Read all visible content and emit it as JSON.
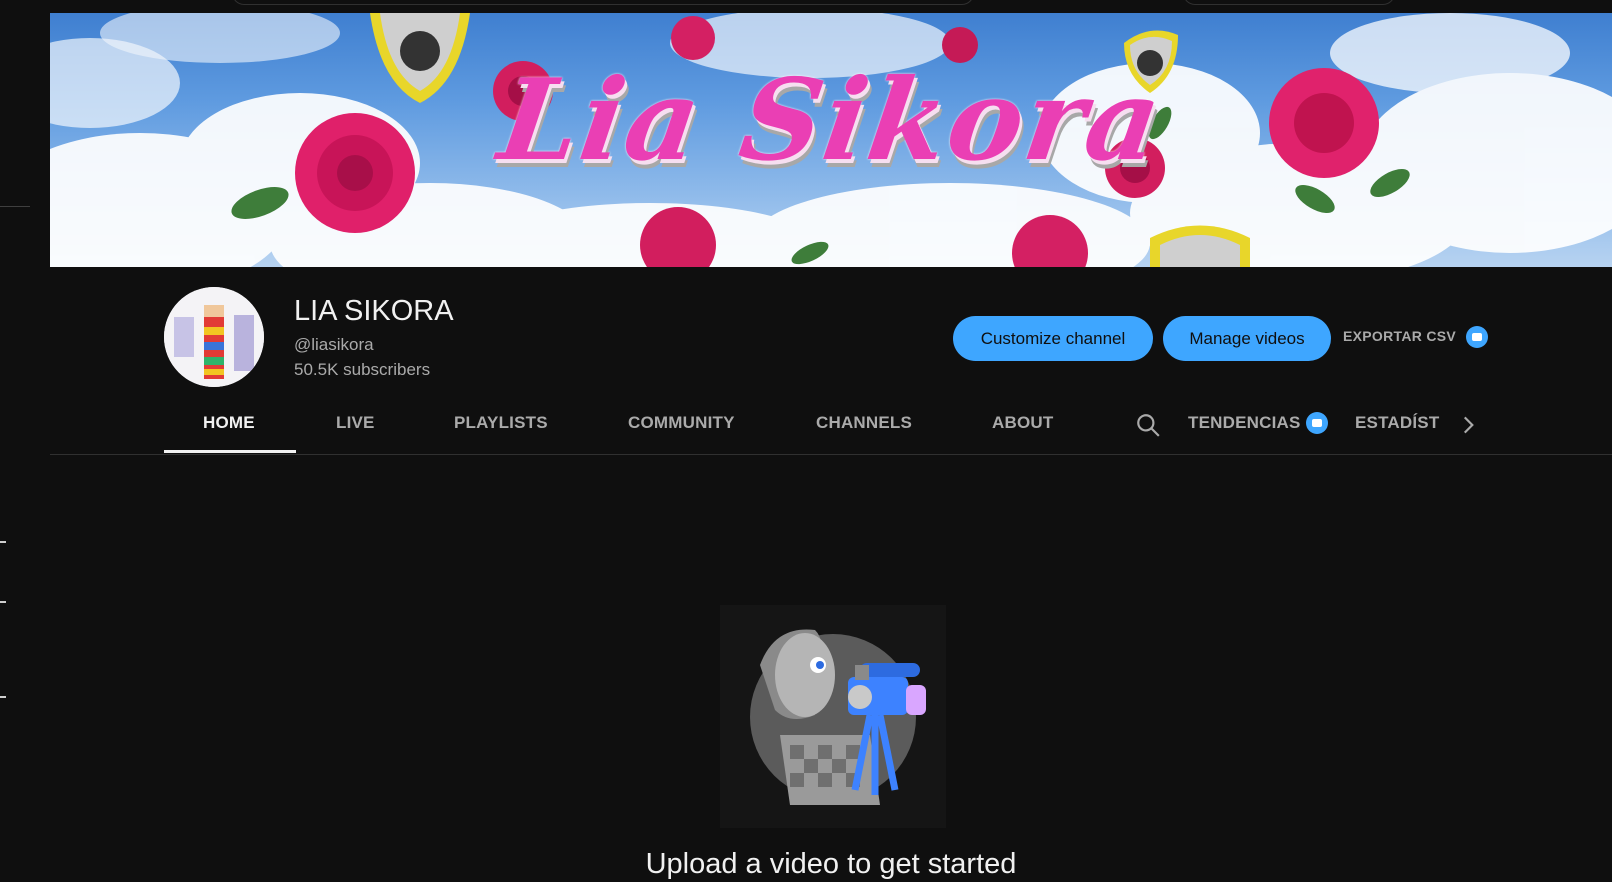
{
  "banner": {
    "title": "Lia Sikora"
  },
  "channel": {
    "name": "LIA SIKORA",
    "handle": "@liasikora",
    "subscribers": "50.5K subscribers"
  },
  "actions": {
    "customize_label": "Customize channel",
    "manage_label": "Manage videos",
    "export_label": "EXPORTAR CSV"
  },
  "tabs": [
    {
      "label": "HOME",
      "active": true
    },
    {
      "label": "LIVE",
      "active": false
    },
    {
      "label": "PLAYLISTS",
      "active": false
    },
    {
      "label": "COMMUNITY",
      "active": false
    },
    {
      "label": "CHANNELS",
      "active": false
    },
    {
      "label": "ABOUT",
      "active": false
    }
  ],
  "extra_tabs": {
    "tendencias": "TENDENCIAS",
    "estadisticas": "ESTADÍST"
  },
  "empty_state": {
    "title": "Upload a video to get started"
  },
  "icons": {
    "search": "search-icon",
    "chevron": "chevron-right-icon",
    "badge": "extension-badge-icon"
  },
  "colors": {
    "background": "#0f0f0f",
    "accent": "#3ea6ff",
    "banner_title": "#ea3fb4"
  }
}
